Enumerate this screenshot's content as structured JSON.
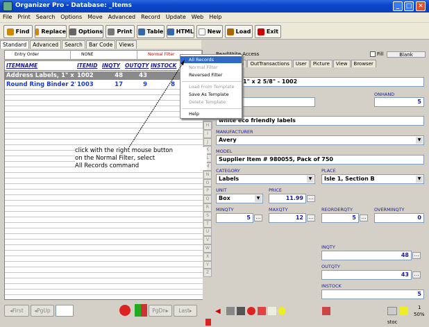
{
  "window": {
    "title": "Organizer Pro - Database: _Items"
  },
  "menu": [
    "File",
    "Print",
    "Search",
    "Options",
    "Move",
    "Advanced",
    "Record",
    "Update",
    "Web",
    "Help"
  ],
  "toolbar": {
    "find": "Find",
    "replace": "Replace",
    "options": "Options",
    "print": "Print",
    "table": "Table",
    "html": "HTML",
    "new": "New",
    "load": "Load",
    "exit": "Exit"
  },
  "view_tabs": [
    "Standard",
    "Advanced",
    "Search",
    "Bar Code",
    "Views"
  ],
  "filters": {
    "sort": "Entry Order",
    "second": "NONE",
    "filter": "Normal Filter"
  },
  "grid": {
    "columns": [
      "ITEMNAME",
      "ITEMID",
      "INQTY",
      "OUTQTY",
      "INSTOCK"
    ],
    "rows": [
      {
        "name": "Address Labels, 1\" x 2 5/",
        "id": "1002",
        "inqty": "48",
        "outqty": "43",
        "instock": ""
      },
      {
        "name": "Round Ring Binder 2\" Ri",
        "id": "1003",
        "inqty": "17",
        "outqty": "9",
        "instock": "8"
      }
    ]
  },
  "nav": {
    "first": "First",
    "pgup": "PgUp",
    "pgdn": "PgDn",
    "last": "Last"
  },
  "alphabet": [
    "H",
    "I",
    "J",
    "K",
    "L",
    "M",
    "N",
    "O",
    "P",
    "Q",
    "R",
    "S",
    "T",
    "U",
    "V",
    "W",
    "X",
    "Y",
    "Z"
  ],
  "context_menu": {
    "items": [
      "All Records",
      "Normal Filter",
      "Reversed Filter",
      "Load From Template",
      "Save As Template",
      "Delete Template",
      "Help"
    ]
  },
  "right": {
    "access": "ReadWrite Access",
    "fill": "Fill",
    "blank": "Blank",
    "tabs": [
      "ransactions",
      "OutTransactions",
      "User",
      "Picture",
      "View",
      "Browser"
    ],
    "itemname_value": "Labels, 1\" x 2 5/8\" - 1002",
    "onhand_label": "ONHAND",
    "onhand_value": "5",
    "desc_label": "N",
    "desc_value": "white eco friendly labels",
    "manufacturer_label": "MANUFACTURER",
    "manufacturer_value": "Avery",
    "model_label": "MODEL",
    "model_value": "Supplier Item # 980055, Pack of 750",
    "category_label": "CATEGORY",
    "category_value": "Labels",
    "place_label": "PLACE",
    "place_value": "Isle 1, Section B",
    "unit_label": "UNIT",
    "unit_value": "Box",
    "price_label": "PRICE",
    "price_value": "11.99",
    "minqty_label": "MINQTY",
    "minqty_value": "5",
    "maxqty_label": "MAXQTY",
    "maxqty_value": "12",
    "reorder_label": "REORDERQTY",
    "reorder_value": "5",
    "overmin_label": "OVERMINQTY",
    "overmin_value": "0",
    "inqty_label": "INQTY",
    "inqty_value": "48",
    "outqty_label": "OUTQTY",
    "outqty_value": "43",
    "instock_label": "INSTOCK",
    "instock_value": "5"
  },
  "status": {
    "record": "1",
    "zoom": "50%",
    "user": "stoc"
  },
  "annotation": "click with the right mouse button\non the Normal Filter, select\nAll Records command"
}
